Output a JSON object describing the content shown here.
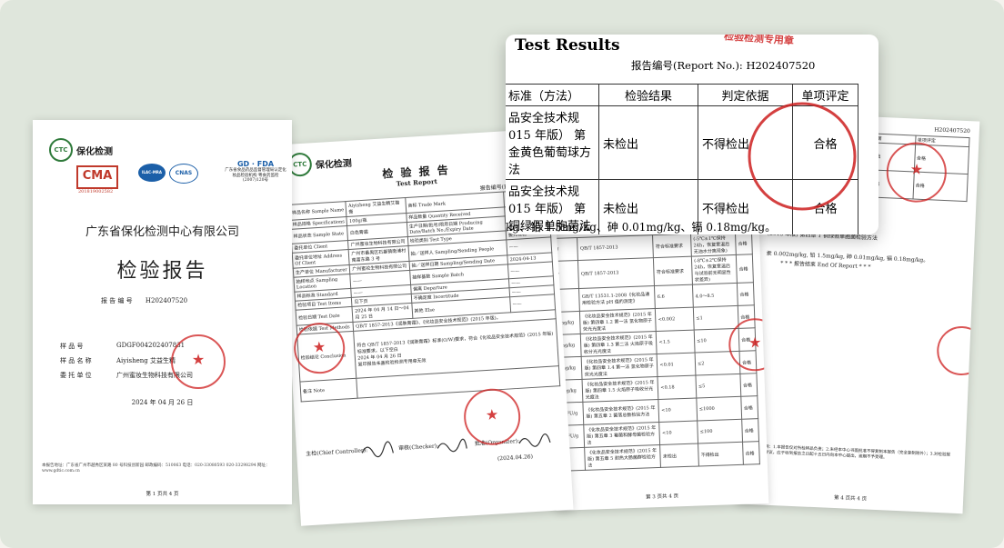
{
  "cover": {
    "logo_text": "保化检测",
    "logo_mark": "CTC",
    "cma_text": "CMA",
    "cma_number": "201819002582",
    "badge1": "ILAC-MRA",
    "badge2": "CNAS",
    "gdfda_title": "GD · FDA",
    "gdfda_lines": "广东省食品药品监督管理局认定化妆品检验机构 粤食药监检(2007)120号",
    "company": "广东省保化检测中心有限公司",
    "title": "检验报告",
    "report_no_label": "报 告 编 号",
    "report_no": "H202407520",
    "sample_no_label": "样 品 号",
    "sample_no": "GDGF004202407831",
    "sample_name_label": "样 品 名 称",
    "sample_name": "Aiyisheng 艾益生精",
    "client_label": "委 托 单 位",
    "client": "广州蜜妆生物科技有限公司",
    "date": "2024 年 04 月 26 日",
    "footer": "本报告地址：广东省广州市越秀区某路 80 号科技创新园 邮政编码：510063 电话：020-33080593 020-33298294 网址：www.gdtic.com.cn",
    "page": "第 1 页共 4 页"
  },
  "page2": {
    "logo_text": "保化检测",
    "title": "检 验 报 告",
    "subtitle": "Test Report",
    "report_no": "报告编号(Report No.): H2",
    "rows": [
      [
        "样品名称 Sample Name",
        "Aiyisheng 艾益生精艾猫膏",
        "商标 Trade Mark",
        "Aiyish"
      ],
      [
        "样品规格 Specifications",
        "100g/瓶",
        "样品数量 Quantity Received",
        "8 瓶"
      ],
      [
        "样品状态 Sample State",
        "白色膏霜",
        "生产日期/批号/限用日期 Producing Date/Batch No./Expiry Date",
        "SJL075142/ 20270411"
      ],
      [
        "委托单位 Client",
        "广州蜜妆生物科技有限公司",
        "检验类别 Test Type",
        "委托检验"
      ],
      [
        "委托单位地址 Address Of Client",
        "广州市番禺区石基镇南浦村南富东路 3 号",
        "抽／送样人 Sampling/Sending People",
        "——"
      ],
      [
        "生产单位 Manufacturer",
        "广州蜜妆生物科技有限公司",
        "抽／送样日期 Sampling/Sending Date",
        "2024-04-13"
      ],
      [
        "抽样地点 Sampling Location",
        "——",
        "抽样基数 Sample Batch",
        "——"
      ],
      [
        "样品标准 Standard",
        "——",
        "偏离 Departure",
        "——"
      ],
      [
        "检验项目 Test Items",
        "见下页",
        "不确定度 Incertitude",
        "——"
      ],
      [
        "检验日期 Test Date",
        "2024 年 04 月 14 日～04 月 25 日",
        "其他 Else",
        "——"
      ]
    ],
    "method_label": "检验依据 Test Methods",
    "method": "QB/T 1857-2013《润肤膏霜》、《化妆品安全技术规范》(2015 年版)。",
    "conclusion_label": "检验结论 Conclusion",
    "conclusion": "符合 QB/T 1857-2013《润肤膏霜》标准(O/W)要求，符合《化妆品安全技术规范》(2015 年版) 标准要求。以下空白",
    "issue_date": "2024 年 04 月 26 日",
    "issue_note": "复印报告未盖检验检测专用章无效",
    "remark_label": "备注 Note",
    "sign_main": "主检(Chief Controller):",
    "sign_check": "审核(Checker):",
    "sign_org": "批准(Organizer):",
    "sign_date": "(2024.04.26)"
  },
  "page3": {
    "rows": [
      [
        "/",
        "QB/T 1857-2013",
        "符合标准要求",
        "(-5℃±1℃保持 24h，恢复室温后无油水分离现象)",
        "合格"
      ],
      [
        "/",
        "QB/T 1857-2013",
        "符合标准要求",
        "(-8℃±2℃保持 24h，恢复室温后与试验前无明显性状差异)",
        "合格"
      ],
      [
        "/",
        "GB/T 13531.1-2008《化妆品通用检验方法 pH 值的测定》",
        "6.6",
        "4.0～8.5",
        "合格"
      ],
      [
        "mg/kg",
        "《化妆品安全技术规范》(2015 年版) 第四章 1.2 第一法 氢化物原子荧光光度法",
        "<0.002",
        "≤1",
        "合格"
      ],
      [
        "mg/kg",
        "《化妆品安全技术规范》(2015 年版) 第四章 1.3 第二法 火焰原子吸收分光光度法",
        "<1.5",
        "≤10",
        "合格"
      ],
      [
        "mg/kg",
        "《化妆品安全技术规范》(2015 年版) 第四章 1.4 第一法 氢化物原子荧光光度法",
        "<0.01",
        "≤2",
        "合格"
      ],
      [
        "mg/kg",
        "《化妆品安全技术规范》(2015 年版) 第四章 1.5 火焰原子吸收分光光度法",
        "<0.18",
        "≤5",
        "合格"
      ],
      [
        "CFU/g",
        "《化妆品安全技术规范》(2015 年版) 第五章 2 菌落总数检验方法",
        "<10",
        "≤1000",
        "合格"
      ],
      [
        "CFU/g",
        "《化妆品安全技术规范》(2015 年版) 第五章 3 霉菌和酵母菌检验方法",
        "<10",
        "≤100",
        "合格"
      ],
      [
        "/g",
        "《化妆品安全技术规范》(2015 年版) 第五章 5 耐热大肠菌群检验方法",
        "未检出",
        "不得检出",
        "合格"
      ]
    ],
    "page": "第 3 页共 4 页"
  },
  "page4": {
    "report_no": "H202407520",
    "header": [
      "判定依据",
      "单项评定"
    ],
    "rows": [
      [
        "不得检出",
        "合格"
      ],
      [
        "不得检出",
        "合格"
      ]
    ],
    "note": "(2015 年版) 第四章 1 铜绿假单胞菌检验方法",
    "limit_text": "汞 0.002mg/kg, 铅 1.5mg/kg, 砷 0.01mg/kg, 镉 0.18mg/kg。",
    "end_text": "* * * 报告结束 End Of Report * * *",
    "footnote": "检验说明：1.本报告仅对所检样品负责；2.未经本中心书面批准不得复制本报告（完全复制除外）；3.对检验报告若有异议，应于收到报告之日起十五日内向本中心提出，逾期不予受理。",
    "page": "第 4 页共 4 页"
  },
  "zoom": {
    "title": "Test Results",
    "report_no": "报告编号(Report No.):  H202407520",
    "stamp_text": "检验检测专用章",
    "headers": [
      "标准（方法）",
      "检验结果",
      "判定依据",
      "单项评定"
    ],
    "rows": [
      {
        "method": "品安全技术规015 年版） 第金黄色葡萄球方法",
        "result": "未检出",
        "basis": "不得检出",
        "verdict": "合格"
      },
      {
        "method": "品安全技术规015 年版） 第铜绿假单胞菌法",
        "result": "未检出",
        "basis": "不得检出",
        "verdict": "合格"
      }
    ],
    "limits": "kg、铅 1.5mg/kg、砷 0.01mg/kg、镉 0.18mg/kg。"
  },
  "colors": {
    "stamp_red": "#cd1e1e",
    "logo_green": "#2f7a3b",
    "cnas_blue": "#1b5fa8",
    "background": "#dfe6dc"
  }
}
